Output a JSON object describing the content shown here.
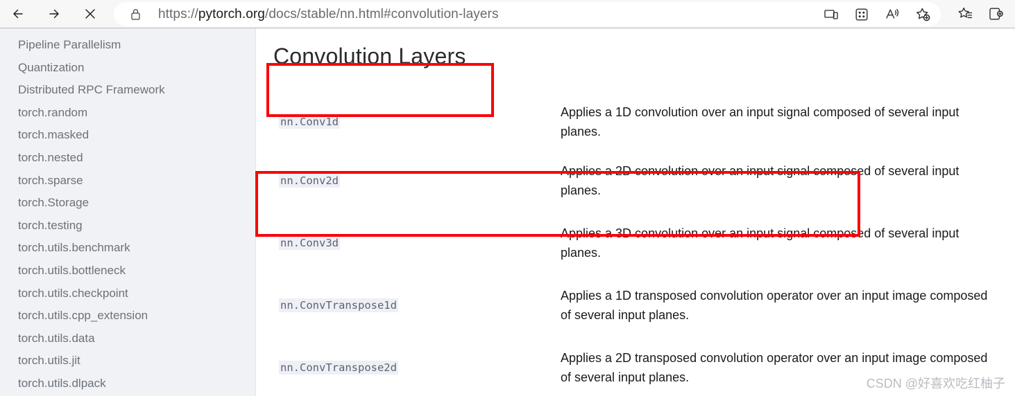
{
  "browser": {
    "back_label": "Back",
    "forward_label": "Forward",
    "stop_label": "Stop",
    "url_prefix": "https://",
    "url_host": "pytorch.org",
    "url_path": "/docs/stable/nn.html#convolution-layers",
    "url_full": "https://pytorch.org/docs/stable/nn.html#convolution-layers",
    "lock_label": "Site information",
    "actions": [
      {
        "name": "cast-to-device-icon",
        "label": "Cast to device"
      },
      {
        "name": "split-screen-icon",
        "label": "Split screen"
      },
      {
        "name": "read-aloud-icon",
        "label": "Read aloud"
      },
      {
        "name": "add-favorite-icon",
        "label": "Add this page to favorites"
      }
    ],
    "outer_actions": [
      {
        "name": "favorites-icon",
        "label": "Favorites"
      },
      {
        "name": "collections-icon",
        "label": "Collections"
      }
    ]
  },
  "sidebar": {
    "items": [
      {
        "label": "Pipeline Parallelism"
      },
      {
        "label": "Quantization"
      },
      {
        "label": "Distributed RPC Framework"
      },
      {
        "label": "torch.random"
      },
      {
        "label": "torch.masked"
      },
      {
        "label": "torch.nested"
      },
      {
        "label": "torch.sparse"
      },
      {
        "label": "torch.Storage"
      },
      {
        "label": "torch.testing"
      },
      {
        "label": "torch.utils.benchmark"
      },
      {
        "label": "torch.utils.bottleneck"
      },
      {
        "label": "torch.utils.checkpoint"
      },
      {
        "label": "torch.utils.cpp_extension"
      },
      {
        "label": "torch.utils.data"
      },
      {
        "label": "torch.utils.jit"
      },
      {
        "label": "torch.utils.dlpack"
      }
    ]
  },
  "main": {
    "title": "Convolution Layers",
    "rows": [
      {
        "name": "nn.Conv1d",
        "description": "Applies a 1D convolution over an input signal composed of several input planes."
      },
      {
        "name": "nn.Conv2d",
        "description": "Applies a 2D convolution over an input signal composed of several input planes."
      },
      {
        "name": "nn.Conv3d",
        "description": "Applies a 3D convolution over an input signal composed of several input planes."
      },
      {
        "name": "nn.ConvTranspose1d",
        "description": "Applies a 1D transposed convolution operator over an input image composed of several input planes."
      },
      {
        "name": "nn.ConvTranspose2d",
        "description": "Applies a 2D transposed convolution operator over an input image composed of several input planes."
      }
    ]
  },
  "annotations": {
    "color": "#fb0007",
    "title_box_label": "Convolution Layers",
    "conv2d_box_label": "nn.Conv2d"
  },
  "watermark": {
    "text": "CSDN @好喜欢吃红柚子"
  }
}
